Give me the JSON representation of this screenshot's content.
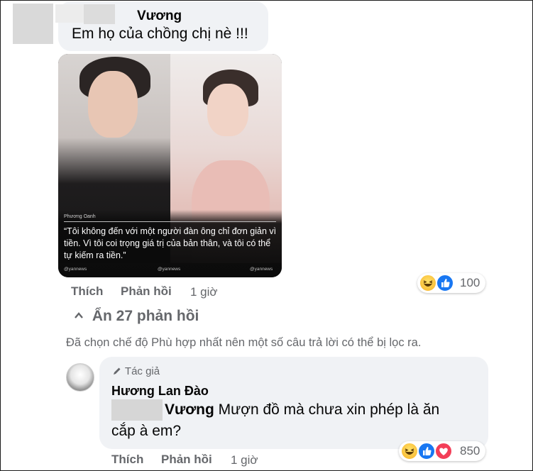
{
  "comment": {
    "author": "Vương",
    "text": "Em họ của chồng chị nè !!!",
    "image": {
      "credit": "Phương Oanh",
      "quote": "“Tôi không đến với một người đàn ông chỉ đơn giản vì tiền. Vì tôi coi trọng giá trị của bản thân, và tôi có thể tự kiếm ra tiền.”",
      "tags": [
        "@yannews",
        "@yannews",
        "@yannews"
      ]
    },
    "like_label": "Thích",
    "reply_label": "Phản hồi",
    "time": "1 giờ",
    "reaction_count": "100",
    "reaction_icons": [
      "haha-icon",
      "like-icon"
    ]
  },
  "replies_toggle": {
    "label": "Ẩn 27 phản hồi"
  },
  "filter_note": "Đã chọn chế độ Phù hợp nhất nên một số câu trả lời có thể bị lọc ra.",
  "reply": {
    "badge": "Tác giả",
    "author": "Hương Lan Đào",
    "mention": "Vương",
    "text_line1": " Mượn đồ mà chưa xin phép là ăn",
    "text_line2": "cắp à em?",
    "like_label": "Thích",
    "reply_label": "Phản hồi",
    "time": "1 giờ",
    "reaction_count": "850",
    "reaction_icons": [
      "haha-icon",
      "like-icon",
      "love-icon"
    ]
  },
  "colors": {
    "bubble": "#f0f2f5",
    "secondary_text": "#65676b",
    "like_blue": "#1877f2",
    "love_red": "#f33e58"
  }
}
